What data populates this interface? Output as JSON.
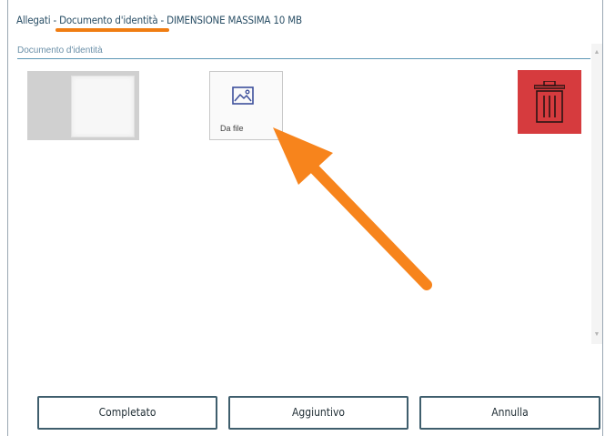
{
  "title_bar": {
    "prefix": "Allegati - ",
    "highlight": "Documento d'identità",
    "suffix": " - DIMENSIONE MASSIMA 10 MB",
    "underline_color": "#f07d12"
  },
  "section": {
    "label": "Documento d'identità"
  },
  "file_picker": {
    "label": "Da file",
    "icon": "image-icon"
  },
  "delete": {
    "icon": "trash-icon",
    "color": "#d63b3e"
  },
  "annotation": {
    "icon": "arrow-icon",
    "color": "#f7841c"
  },
  "footer": {
    "completato_label": "Completato",
    "aggiuntivo_label": "Aggiuntivo",
    "annulla_label": "Annulla"
  }
}
